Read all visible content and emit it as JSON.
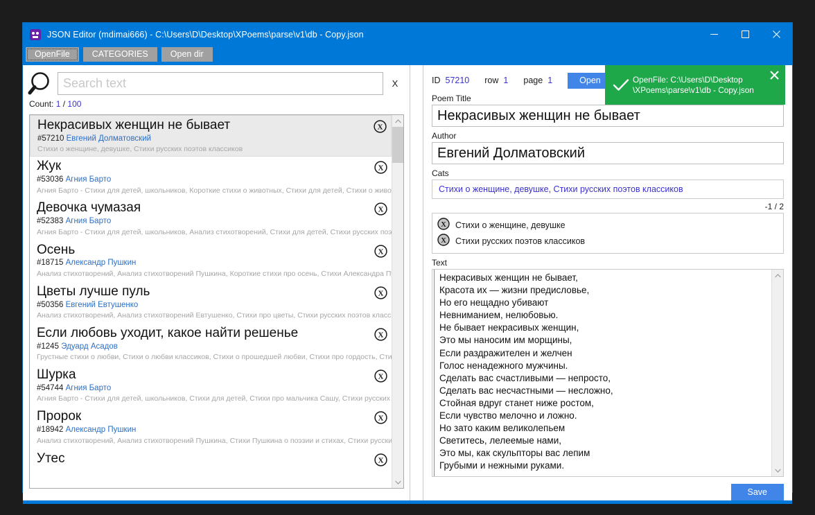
{
  "window": {
    "title": "JSON Editor (mdimai666) - C:\\Users\\D\\Desktop\\XPoems\\parse\\v1\\db - Copy.json",
    "icon": "app-icon",
    "minimize": "—",
    "maximize": "□",
    "close": "✕",
    "accent_color": "#0078d7"
  },
  "tabs": [
    {
      "label": "OpenFile",
      "focused": true
    },
    {
      "label": "CATEGORIES",
      "focused": false
    },
    {
      "label": "Open dir",
      "focused": false
    }
  ],
  "search": {
    "placeholder": "Search text",
    "value": "",
    "clear_label": "X",
    "icon": "magnifier-icon"
  },
  "count": {
    "label": "Count:",
    "current": "1",
    "separator": "/",
    "total": "100"
  },
  "list": [
    {
      "title": "Некрасивых женщин не бывает",
      "id": "#57210",
      "author": "Евгений Долматовский",
      "cats": "Стихи о женщине, девушке, Стихи русских поэтов классиков",
      "selected": true
    },
    {
      "title": "Жук",
      "id": "#53036",
      "author": "Агния Барто",
      "cats": "Агния Барто - Стихи для детей, школьников, Короткие стихи о животных, Стихи для детей, Стихи о животны",
      "selected": false
    },
    {
      "title": "Девочка чумазая",
      "id": "#52383",
      "author": "Агния Барто",
      "cats": "Агния Барто - Стихи для детей, школьников, Анализ стихотворений, Стихи для детей, Стихи русских поэтов",
      "selected": false
    },
    {
      "title": "Осень",
      "id": "#18715",
      "author": "Александр Пушкин",
      "cats": "Анализ стихотворений, Анализ стихотворений Пушкина, Короткие стихи про осень, Стихи Александра Пуш",
      "selected": false
    },
    {
      "title": "Цветы лучше пуль",
      "id": "#50356",
      "author": "Евгений Евтушенко",
      "cats": "Анализ стихотворений, Анализ стихотворений Евтушенко, Стихи про цветы, Стихи русских поэтов классикс",
      "selected": false
    },
    {
      "title": "Если любовь уходит, какое найти решенье",
      "id": "#1245",
      "author": "Эдуард Асадов",
      "cats": "Грустные стихи о любви, Стихи о любви классиков, Стихи о прошедшей любви, Стихи про гордость, Стихи",
      "selected": false
    },
    {
      "title": "Шурка",
      "id": "#54744",
      "author": "Агния Барто",
      "cats": "Агния Барто - Стихи для детей, школьников, Стихи для детей, Стихи про мальчика Сашу, Стихи русских поэ",
      "selected": false
    },
    {
      "title": "Пророк",
      "id": "#18942",
      "author": "Александр Пушкин",
      "cats": "Анализ стихотворений, Анализ стихотворений Пушкина, Стихи Пушкина о поэзии и стихах, Стихи русских п",
      "selected": false
    },
    {
      "title": "Утес",
      "id": "",
      "author": "",
      "cats": "",
      "selected": false
    }
  ],
  "detail": {
    "id_label": "ID",
    "id_value": "57210",
    "row_label": "row",
    "row_value": "1",
    "page_label": "page",
    "page_value": "1",
    "open_button": "Open",
    "title_label": "Poem Title",
    "title_value": "Некрасивых женщин не бывает",
    "author_label": "Author",
    "author_value": "Евгений Долматовский",
    "cats_label": "Cats",
    "cats_value": "Стихи о женщине, девушке, Стихи русских поэтов классиков",
    "cats_counter": "-1 / 2",
    "cat_items": [
      "Стихи о женщине, девушке",
      "Стихи русских поэтов классиков"
    ],
    "text_label": "Text",
    "text_value": "Некрасивых женщин не бывает,\nКрасота их — жизни предисловье,\nНо его нещадно убивают\nНевниманием, нелюбовью.\nНе бывает некрасивых женщин,\nЭто мы наносим им морщины,\nЕсли раздражителен и желчен\nГолос ненадежного мужчины.\nСделать вас счастливыми — непросто,\nСделать вас несчастными — несложно,\nСтойная вдруг станет ниже ростом,\nЕсли чувство мелочно и ложно.\nНо зато каким великолепьем\nСветитесь, лелеемые нами,\nЭто мы, как скульпторы вас лепим\nГрубыми и нежными руками.",
    "save_button": "Save"
  },
  "toast": {
    "message": "OpenFile: C:\\Users\\D\\Desktop\n\\XPoems\\parse\\v1\\db - Copy.json",
    "icon": "check-icon",
    "close": "✕",
    "color": "#1fa84a"
  }
}
